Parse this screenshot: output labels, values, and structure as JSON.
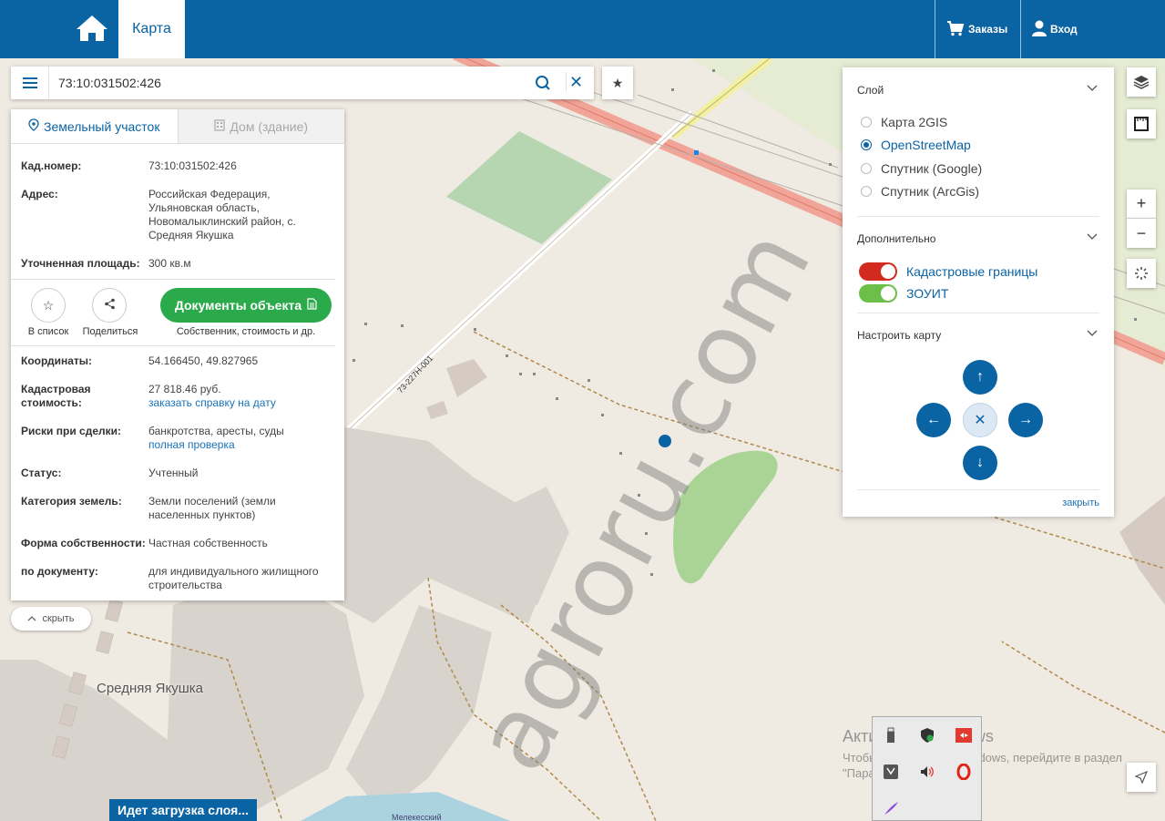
{
  "header": {
    "tab_map": "Карта",
    "orders": "Заказы",
    "login": "Вход"
  },
  "search": {
    "value": "73:10:031502:426"
  },
  "panel": {
    "tab_land": "Земельный участок",
    "tab_house": "Дом (здание)",
    "fields_top": [
      {
        "key": "Кад.номер:",
        "value": "73:10:031502:426",
        "link": true
      },
      {
        "key": "Адрес:",
        "value": "Российская Федерация, Ульяновская область, Новомалыклинский район, с. Средняя Якушка"
      },
      {
        "key": "Уточненная площадь:",
        "value": "300 кв.м"
      }
    ],
    "action_list": "В список",
    "action_share": "Поделиться",
    "docs_button": "Документы объекта",
    "docs_sub": "Собственник, стоимость и др.",
    "coords_key": "Координаты:",
    "coords_value": "54.166450, 49.827965",
    "cost_key": "Кадастровая стоимость:",
    "cost_value": "27 818.46 руб.",
    "cost_link": "заказать справку на дату",
    "risk_key": "Риски при сделки:",
    "risk_value": "банкротства, аресты, суды",
    "risk_link": "полная проверка",
    "status_key": "Статус:",
    "status_value": "Учтенный",
    "category_key": "Категория земель:",
    "category_value": "Земли поселений (земли населенных пунктов)",
    "ownership_key": "Форма собственности:",
    "ownership_value": "Частная собственность",
    "doc_key": "по документу:",
    "doc_value": "для индивидуального жилищного строительства"
  },
  "hide_button": "скрыть",
  "layers": {
    "section_layer": "Слой",
    "options": [
      "Карта 2GIS",
      "OpenStreetMap",
      "Спутник (Google)",
      "Спутник (ArcGis)"
    ],
    "selected": "OpenStreetMap",
    "section_extra": "Дополнительно",
    "toggle_cadastral": "Кадастровые границы",
    "toggle_zouit": "ЗОУИТ",
    "section_configure": "Настроить карту",
    "close": "закрыть"
  },
  "map": {
    "place": "Средняя Якушка",
    "road_label": "73-227Н-001",
    "watermark": "agroru.com",
    "water_label": "Мелекесский",
    "loading": "Идет загрузка слоя..."
  },
  "windows": {
    "title": "Активация Windows",
    "text": "Чтобы активировать Windows, перейдите в раздел \"Параметры\"."
  },
  "colors": {
    "brand": "#0a63a3",
    "green": "#2aaa4a",
    "toggle_red": "#d22a1e",
    "toggle_green": "#6cc04a"
  }
}
